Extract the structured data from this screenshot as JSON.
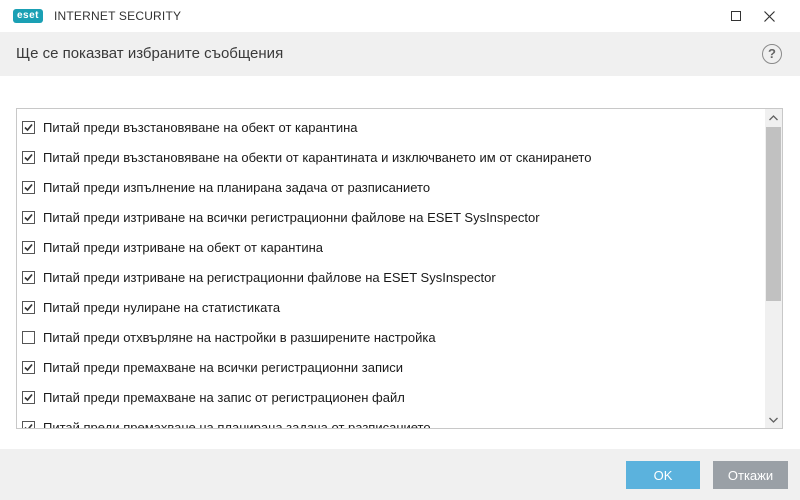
{
  "window": {
    "brand": "eset",
    "product": "INTERNET SECURITY",
    "maximize_icon": "square-outline",
    "close_icon": "x-mark"
  },
  "header": {
    "title": "Ще се показват избраните съобщения",
    "help_label": "?"
  },
  "messages": [
    {
      "label": "Питай преди възстановяване на обект от карантина",
      "checked": true
    },
    {
      "label": "Питай преди възстановяване на обекти от карантината и изключването им от сканирането",
      "checked": true
    },
    {
      "label": "Питай преди изпълнение на планирана задача от разписанието",
      "checked": true
    },
    {
      "label": "Питай преди изтриване на всички регистрационни файлове на ESET SysInspector",
      "checked": true
    },
    {
      "label": "Питай преди изтриване на обект от карантина",
      "checked": true
    },
    {
      "label": "Питай преди изтриване на регистрационни файлове на ESET SysInspector",
      "checked": true
    },
    {
      "label": "Питай преди нулиране на статистиката",
      "checked": true
    },
    {
      "label": "Питай преди отхвърляне на настройки в разширените настройка",
      "checked": false
    },
    {
      "label": "Питай преди премахване на всички регистрационни записи",
      "checked": true
    },
    {
      "label": "Питай преди премахване на запис от регистрационен файл",
      "checked": true
    },
    {
      "label": "Питай преди премахване на планирана задача от разписанието",
      "checked": true
    }
  ],
  "footer": {
    "ok_label": "OK",
    "cancel_label": "Откажи"
  },
  "colors": {
    "brand": "#1aa0b4",
    "ok_button": "#5bb2dd",
    "cancel_button": "#9aa0a6",
    "header_bg": "#f0f0f0"
  }
}
